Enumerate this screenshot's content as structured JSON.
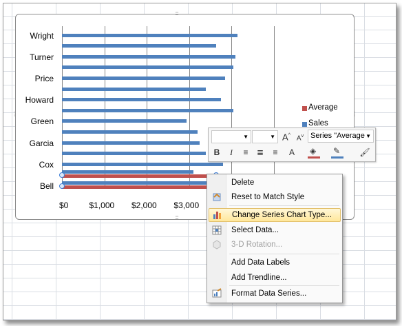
{
  "chart": {
    "categories_shown": [
      "Wright",
      "Turner",
      "Price",
      "Howard",
      "Green",
      "Garcia",
      "Cox",
      "Bell"
    ],
    "x_ticks": [
      "$0",
      "$1,000",
      "$2,000",
      "$3,000"
    ],
    "legend": [
      {
        "label": "Average",
        "color": "#c0504d"
      },
      {
        "label": "Sales",
        "color": "#4f81bd"
      }
    ]
  },
  "chart_data": {
    "type": "bar",
    "orientation": "horizontal",
    "categories": [
      "Bell",
      "",
      "Cox",
      "",
      "Garcia",
      "",
      "Green",
      "",
      "Howard",
      "",
      "Price",
      "",
      "Turner",
      "",
      "Wright"
    ],
    "series": [
      {
        "name": "Sales",
        "color": "#4f81bd",
        "values": [
          3650,
          3100,
          3800,
          3400,
          3250,
          3200,
          2950,
          4050,
          3750,
          3400,
          3850,
          4050,
          4100,
          3650,
          4150
        ]
      },
      {
        "name": "Average",
        "color": "#c0504d",
        "values": [
          3650,
          3650,
          null,
          null,
          null,
          null,
          null,
          null,
          null,
          null,
          null,
          null,
          null,
          null,
          null
        ]
      }
    ],
    "xlim": [
      0,
      5000
    ],
    "x_tick_labels": [
      "$0",
      "$1,000",
      "$2,000",
      "$3,000"
    ],
    "legend_position": "right",
    "grid": true
  },
  "mini_toolbar": {
    "series_dropdown": "Series \"Average",
    "bold": "B",
    "italic": "I",
    "grow_font": "A",
    "shrink_font": "A"
  },
  "context_menu": {
    "items": [
      {
        "label": "Delete",
        "icon": "none",
        "enabled": true
      },
      {
        "label": "Reset to Match Style",
        "icon": "reset-style-icon",
        "enabled": true
      },
      {
        "label": "Change Series Chart Type...",
        "icon": "chart-type-icon",
        "enabled": true,
        "highlighted": true
      },
      {
        "label": "Select Data...",
        "icon": "select-data-icon",
        "enabled": true
      },
      {
        "label": "3-D Rotation...",
        "icon": "3d-rotation-icon",
        "enabled": false
      },
      {
        "label": "Add Data Labels",
        "icon": "none",
        "enabled": true
      },
      {
        "label": "Add Trendline...",
        "icon": "none",
        "enabled": true
      },
      {
        "label": "Format Data Series...",
        "icon": "format-series-icon",
        "enabled": true
      }
    ]
  }
}
